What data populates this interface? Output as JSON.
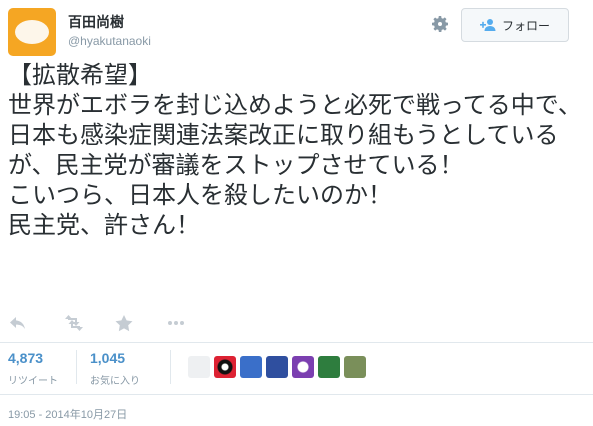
{
  "author": {
    "name": "百田尚樹",
    "handle": "@hyakutanaoki"
  },
  "follow_button": {
    "icon": "add-user-icon",
    "label": "フォロー"
  },
  "tweet_text": "【拡散希望】\n世界がエボラを封じ込めようと必死で戦ってる中で、日本も感染症関連法案改正に取り組もうとしているが、民主党が審議をストップさせている！\nこいつら、日本人を殺したいのか！\n民主党、許さん！",
  "actions": [
    "reply-icon",
    "retweet-icon",
    "favorite-icon",
    "more-icon"
  ],
  "stats": {
    "retweets": {
      "count": "4,873",
      "label": "リツイート"
    },
    "favorites": {
      "count": "1,045",
      "label": "お気に入り"
    }
  },
  "favoriters": [
    "avatar-1",
    "avatar-2",
    "avatar-3",
    "avatar-4",
    "avatar-5",
    "avatar-6",
    "avatar-7"
  ],
  "timestamp": "19:05 - 2014年10月27日",
  "colors": {
    "link": "#4a90c9",
    "muted": "#8899a6",
    "accent": "#55acee"
  }
}
